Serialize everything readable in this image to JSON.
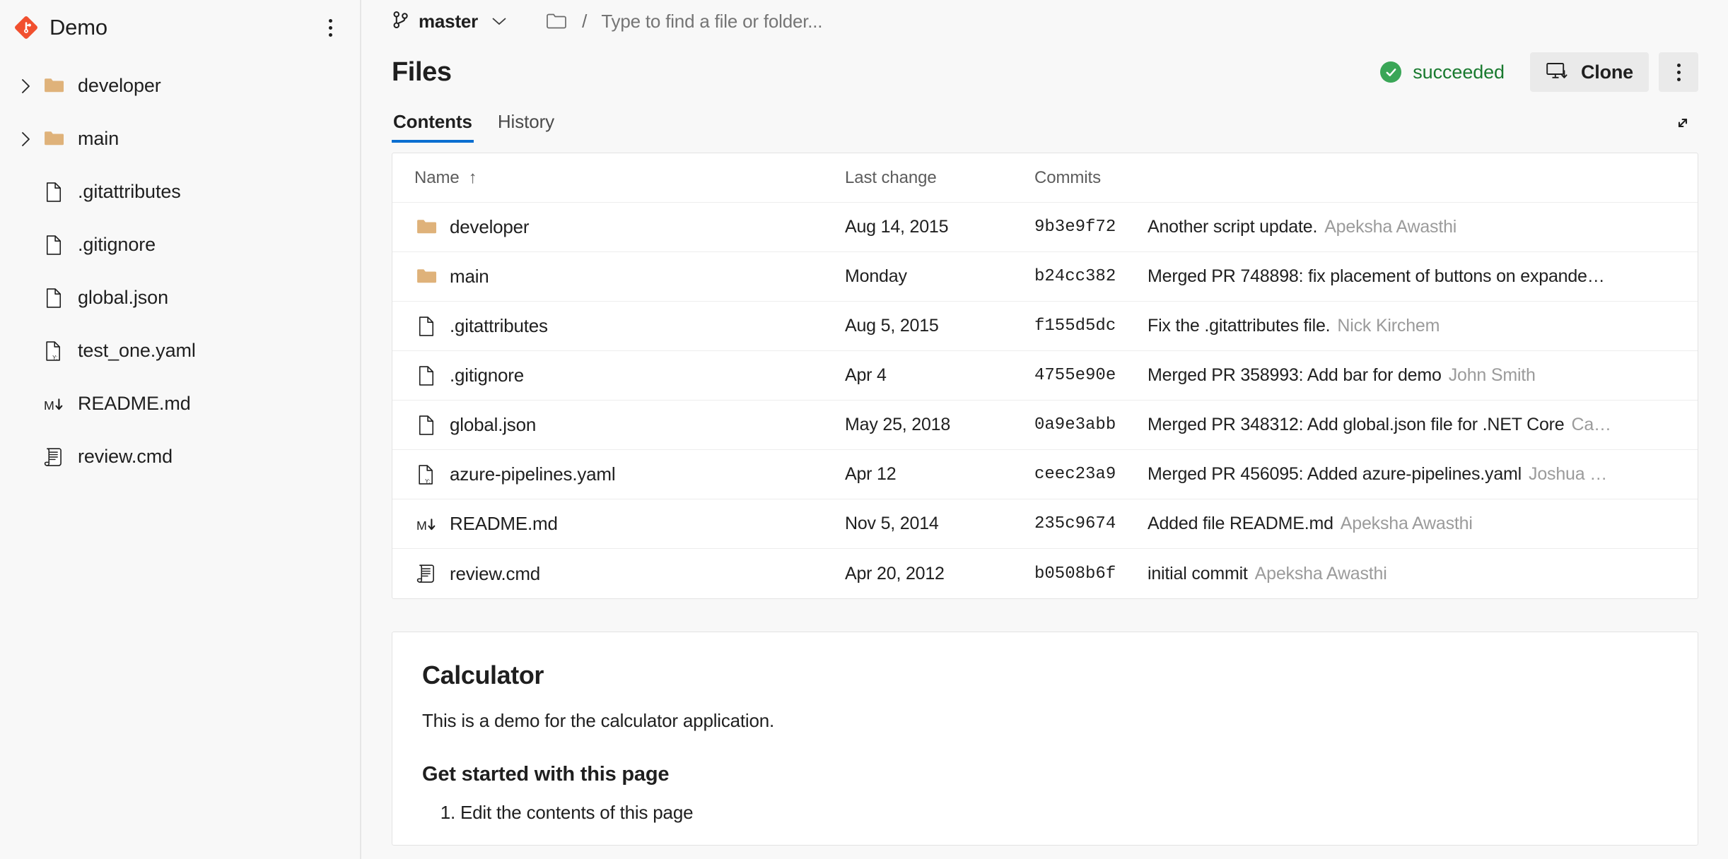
{
  "sidebar": {
    "repo_name": "Demo",
    "logo_color": "#f1502f",
    "more_menu_label": "More options",
    "tree": [
      {
        "label": "developer",
        "type": "folder",
        "expandable": true,
        "icon": "folder-icon"
      },
      {
        "label": "main",
        "type": "folder",
        "expandable": true,
        "icon": "folder-icon"
      },
      {
        "label": ".gitattributes",
        "type": "file",
        "expandable": false,
        "icon": "file-icon"
      },
      {
        "label": ".gitignore",
        "type": "file",
        "expandable": false,
        "icon": "file-icon"
      },
      {
        "label": "global.json",
        "type": "file",
        "expandable": false,
        "icon": "file-icon"
      },
      {
        "label": "test_one.yaml",
        "type": "file",
        "expandable": false,
        "icon": "yaml-file-icon"
      },
      {
        "label": "README.md",
        "type": "file",
        "expandable": false,
        "icon": "markdown-icon"
      },
      {
        "label": "review.cmd",
        "type": "file",
        "expandable": false,
        "icon": "script-icon"
      }
    ]
  },
  "topbar": {
    "branch": "master",
    "separator": "/",
    "path_placeholder": "Type to find a file or folder...",
    "path_value": ""
  },
  "header": {
    "title": "Files",
    "status_text": "succeeded",
    "status_color": "#197a2f",
    "status_badge_color": "#3aa657",
    "clone_label": "Clone",
    "more_label": "More actions",
    "expand_label": "Expand"
  },
  "tabs": [
    {
      "label": "Contents",
      "active": true
    },
    {
      "label": "History",
      "active": false
    }
  ],
  "table": {
    "columns": [
      "Name",
      "Last change",
      "Commits",
      ""
    ],
    "sort_column": "Name",
    "sort_direction": "↑",
    "rows": [
      {
        "name": "developer",
        "icon": "folder-icon",
        "last_change": "Aug 14, 2015",
        "commit": "9b3e9f72",
        "message": "Another script update.",
        "author": "Apeksha Awasthi"
      },
      {
        "name": "main",
        "icon": "folder-icon",
        "last_change": "Monday",
        "commit": "b24cc382",
        "message": "Merged PR 748898: fix placement of buttons on expande…",
        "author": ""
      },
      {
        "name": ".gitattributes",
        "icon": "file-icon",
        "last_change": "Aug 5, 2015",
        "commit": "f155d5dc",
        "message": "Fix the .gitattributes file.",
        "author": "Nick Kirchem"
      },
      {
        "name": ".gitignore",
        "icon": "file-icon",
        "last_change": "Apr 4",
        "commit": "4755e90e",
        "message": "Merged PR 358993: Add bar for demo",
        "author": "John Smith"
      },
      {
        "name": "global.json",
        "icon": "file-icon",
        "last_change": "May 25, 2018",
        "commit": "0a9e3abb",
        "message": "Merged PR 348312: Add global.json file for .NET Core",
        "author": "Ca…"
      },
      {
        "name": "azure-pipelines.yaml",
        "icon": "yaml-file-icon",
        "last_change": "Apr 12",
        "commit": "ceec23a9",
        "message": "Merged PR 456095: Added azure-pipelines.yaml",
        "author": "Joshua …"
      },
      {
        "name": "README.md",
        "icon": "markdown-icon",
        "last_change": "Nov 5, 2014",
        "commit": "235c9674",
        "message": "Added file README.md",
        "author": "Apeksha Awasthi"
      },
      {
        "name": "review.cmd",
        "icon": "script-icon",
        "last_change": "Apr 20, 2012",
        "commit": "b0508b6f",
        "message": "initial commit",
        "author": "Apeksha Awasthi"
      }
    ]
  },
  "readme": {
    "heading": "Calculator",
    "paragraph": "This is a demo for the calculator application.",
    "subheading": "Get started with this page",
    "list_items": [
      "Edit the contents of this page"
    ]
  }
}
